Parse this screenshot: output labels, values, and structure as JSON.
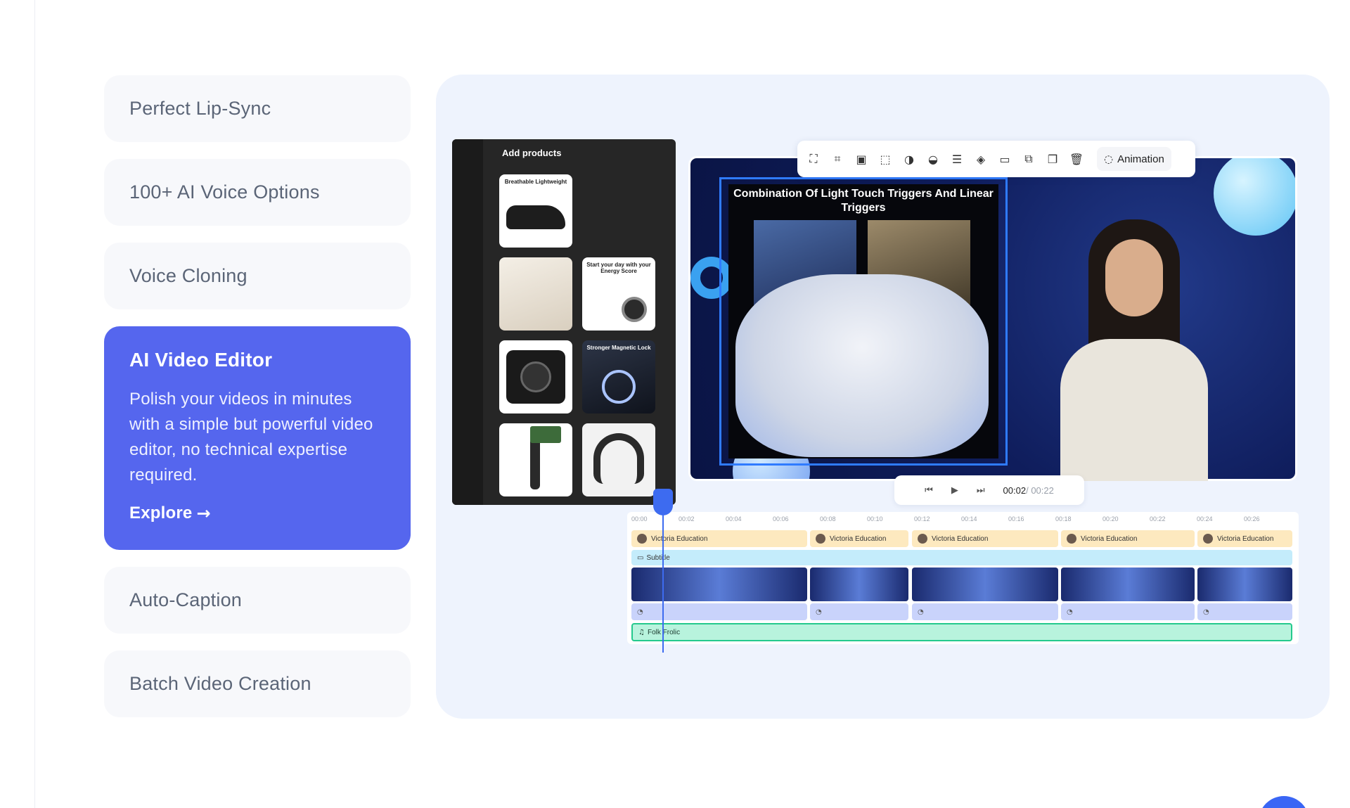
{
  "features": [
    {
      "title": "Perfect Lip-Sync"
    },
    {
      "title": "100+ AI Voice Options"
    },
    {
      "title": "Voice Cloning"
    },
    {
      "title": "AI Video Editor",
      "description": "Polish your videos in minutes with a simple but powerful video editor, no technical expertise required.",
      "cta": "Explore",
      "active": true
    },
    {
      "title": "Auto-Caption"
    },
    {
      "title": "Batch Video Creation"
    }
  ],
  "editor": {
    "products_title": "Add products",
    "product_captions": [
      "Breathable Lightweight",
      "",
      "Start your day with your Energy Score",
      "",
      "Stronger Magnetic Lock",
      "",
      "",
      ""
    ],
    "video_title": "Combination Of Light Touch Triggers And Linear Triggers",
    "toolbar": {
      "icons": [
        "group-icon",
        "crop-icon",
        "image-icon",
        "mask-icon",
        "contrast-icon",
        "color-icon",
        "align-icon",
        "layers-icon",
        "api-icon",
        "replace-icon",
        "duplicate-icon",
        "delete-icon"
      ],
      "animation_label": "Animation"
    },
    "playback": {
      "current": "00:02",
      "duration": "/ 00:22"
    },
    "ruler": [
      "00:00",
      "00:02",
      "00:04",
      "00:06",
      "00:08",
      "00:10",
      "00:12",
      "00:14",
      "00:16",
      "00:18",
      "00:20",
      "00:22",
      "00:24",
      "00:26"
    ],
    "avatar_segments": [
      "Victoria Education",
      "Victoria Education",
      "Victoria Education",
      "Victoria Education",
      "Victoria Education"
    ],
    "subtitle_label": "Subtitle",
    "music_label": "Folk Frolic"
  },
  "colors": {
    "accent": "#5566ee",
    "panel": "#eef3fd",
    "playhead": "#3d6bf0",
    "music": "#24c98d"
  }
}
